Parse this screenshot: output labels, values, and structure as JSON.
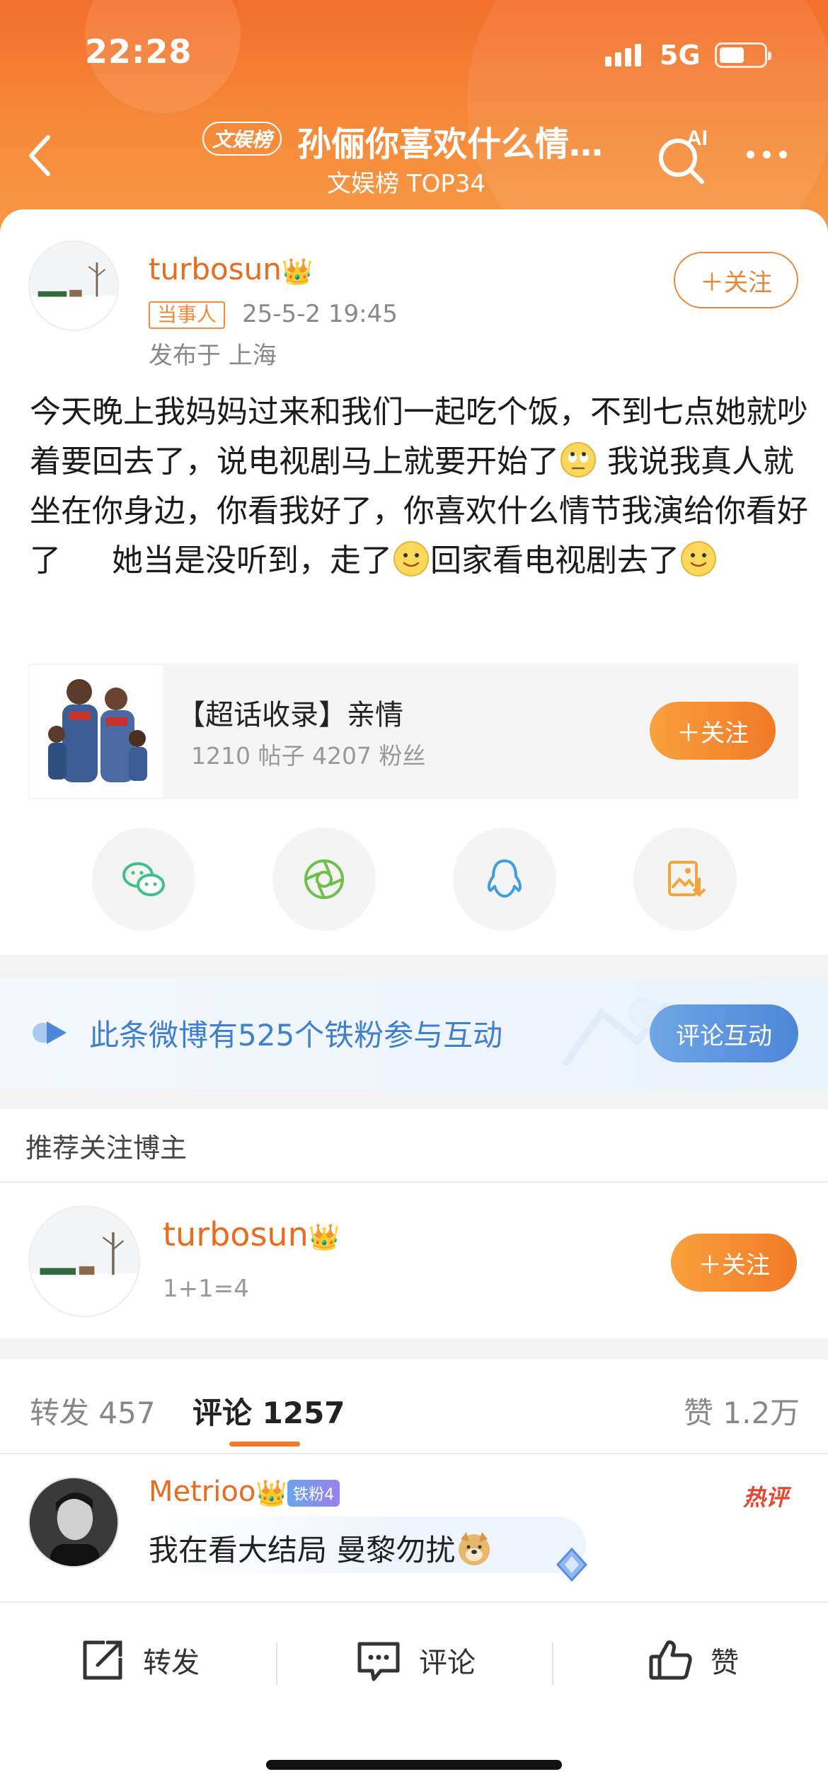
{
  "status_bar": {
    "time": "22:28",
    "network": "5G"
  },
  "header": {
    "tag": "文娱榜",
    "title": "孙俪你喜欢什么情节我演给你看好了",
    "subtitle": "文娱榜 TOP34",
    "search_badge": "AI"
  },
  "post": {
    "author": "turbosun",
    "role_tag": "当事人",
    "time": "25-5-2 19:45",
    "location": "发布于 上海",
    "follow_label": "＋关注",
    "text_parts": [
      "今天晚上我妈妈过来和我们一起吃个饭，不到七点她就吵着要回去了，说电视剧马上就要开始了",
      " 我说我真人就坐在你身边，你看我好了，你喜欢什么情节我演给你看好了 　 她当是没听到，走了",
      "回家看电视剧去了"
    ]
  },
  "topic": {
    "title": "【超话收录】亲情",
    "stats": "1210 帖子 4207 粉丝",
    "follow_label": "＋关注"
  },
  "share": [
    "wechat-icon",
    "moments-icon",
    "qq-icon",
    "save-image-icon"
  ],
  "iron_fans": {
    "text": "此条微博有525个铁粉参与互动",
    "button": "评论互动"
  },
  "recommend": {
    "heading": "推荐关注博主",
    "name": "turbosun",
    "desc": "1+1=4",
    "follow_label": "＋关注"
  },
  "tabs": {
    "repost": {
      "label": "转发",
      "count": "457"
    },
    "comment": {
      "label": "评论",
      "count": "1257"
    },
    "like": {
      "label": "赞",
      "count": "1.2万"
    }
  },
  "comment": {
    "name": "Metrioo",
    "fan_badge": "铁粉4",
    "hot": "热评",
    "text": "我在看大结局 曼黎勿扰"
  },
  "bottom_bar": {
    "repost": "转发",
    "comment": "评论",
    "like": "赞"
  },
  "colors": {
    "brand_orange": "#f07a28",
    "link_blue": "#3f7fcf"
  }
}
